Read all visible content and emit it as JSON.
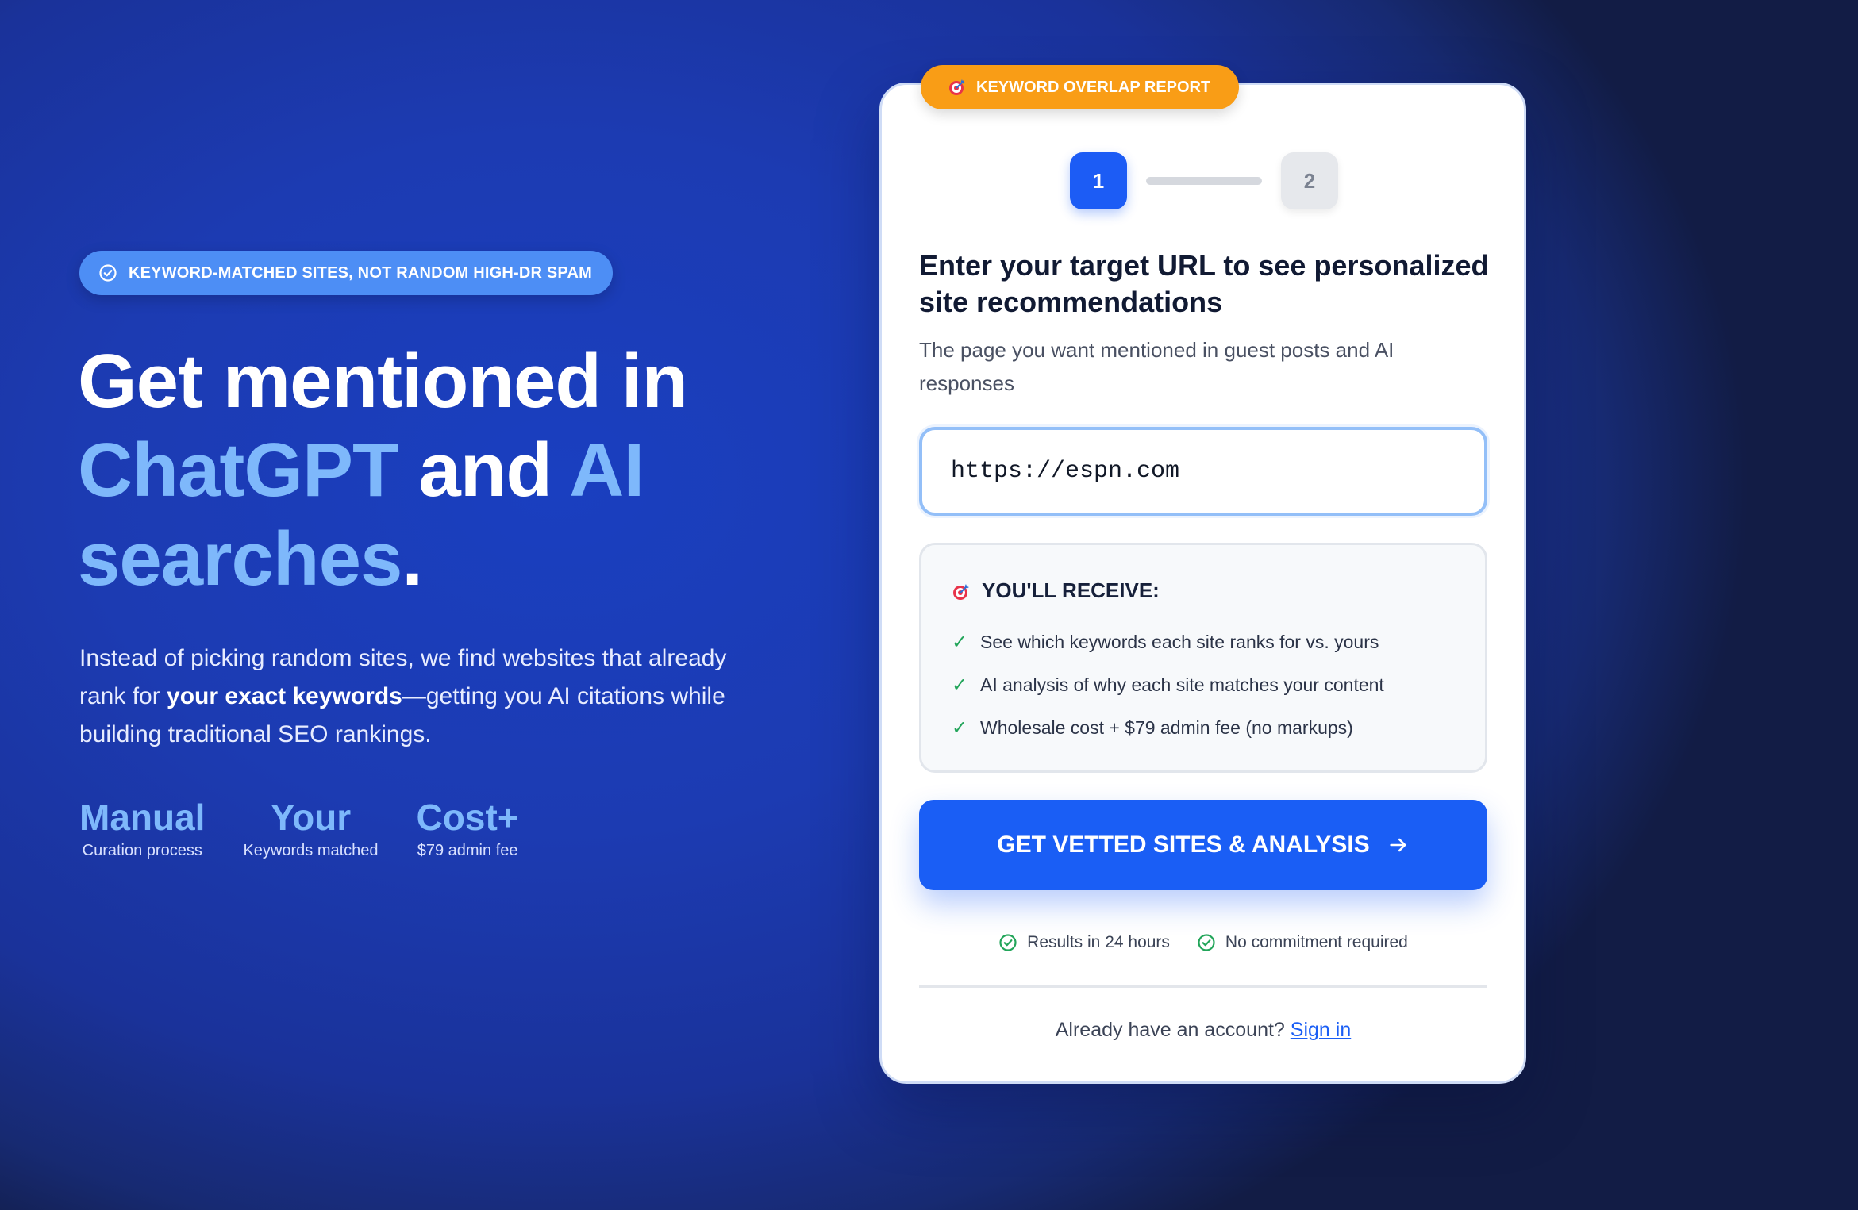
{
  "hero": {
    "pill_text": "KEYWORD-MATCHED SITES, NOT RANDOM HIGH-DR SPAM",
    "headline": {
      "part1": "Get mentioned in",
      "part2_highlight": "ChatGPT",
      "part3": " and ",
      "part4_highlight": "AI",
      "part5_highlight": "searches",
      "part6": "."
    },
    "lead": {
      "before": "Instead of picking random sites, we find websites that already rank for ",
      "bold": "your exact keywords",
      "after": "—getting you AI citations while building traditional SEO rankings."
    },
    "stats": [
      {
        "value": "Manual",
        "label": "Curation process"
      },
      {
        "value": "Your",
        "label": "Keywords matched"
      },
      {
        "value": "Cost+",
        "label": "$79 admin fee"
      }
    ]
  },
  "card": {
    "badge_text": "KEYWORD OVERLAP REPORT",
    "steps": [
      "1",
      "2"
    ],
    "active_step": 1,
    "title": "Enter your target URL to see personalized site recommendations",
    "subtitle": "The page you want mentioned in guest posts and AI responses",
    "url_input": {
      "value": "https://espn.com",
      "placeholder": ""
    },
    "receive": {
      "title": "YOU'LL RECEIVE:",
      "check_glyph": "✓",
      "items": [
        "See which keywords each site ranks for vs. yours",
        "AI analysis of why each site matches your content",
        "Wholesale cost + $79 admin fee (no markups)"
      ]
    },
    "cta_label": "GET VETTED SITES & ANALYSIS",
    "assurances": [
      "Results in 24 hours",
      "No commitment required"
    ],
    "signin": {
      "prompt": "Already have an account?",
      "link": "Sign in"
    }
  },
  "icons": {
    "pill": "check-circle-icon",
    "badge": "target-icon",
    "receive": "target-icon",
    "cta": "arrow-right-icon",
    "assurance": "check-circle-icon"
  },
  "colors": {
    "background": "#1c3bb2",
    "highlight_text": "#7eb8fb",
    "pill": "#4d8ef5",
    "badge": "#f99d16",
    "primary_button": "#1a5ef5",
    "check_green": "#22a55a"
  }
}
